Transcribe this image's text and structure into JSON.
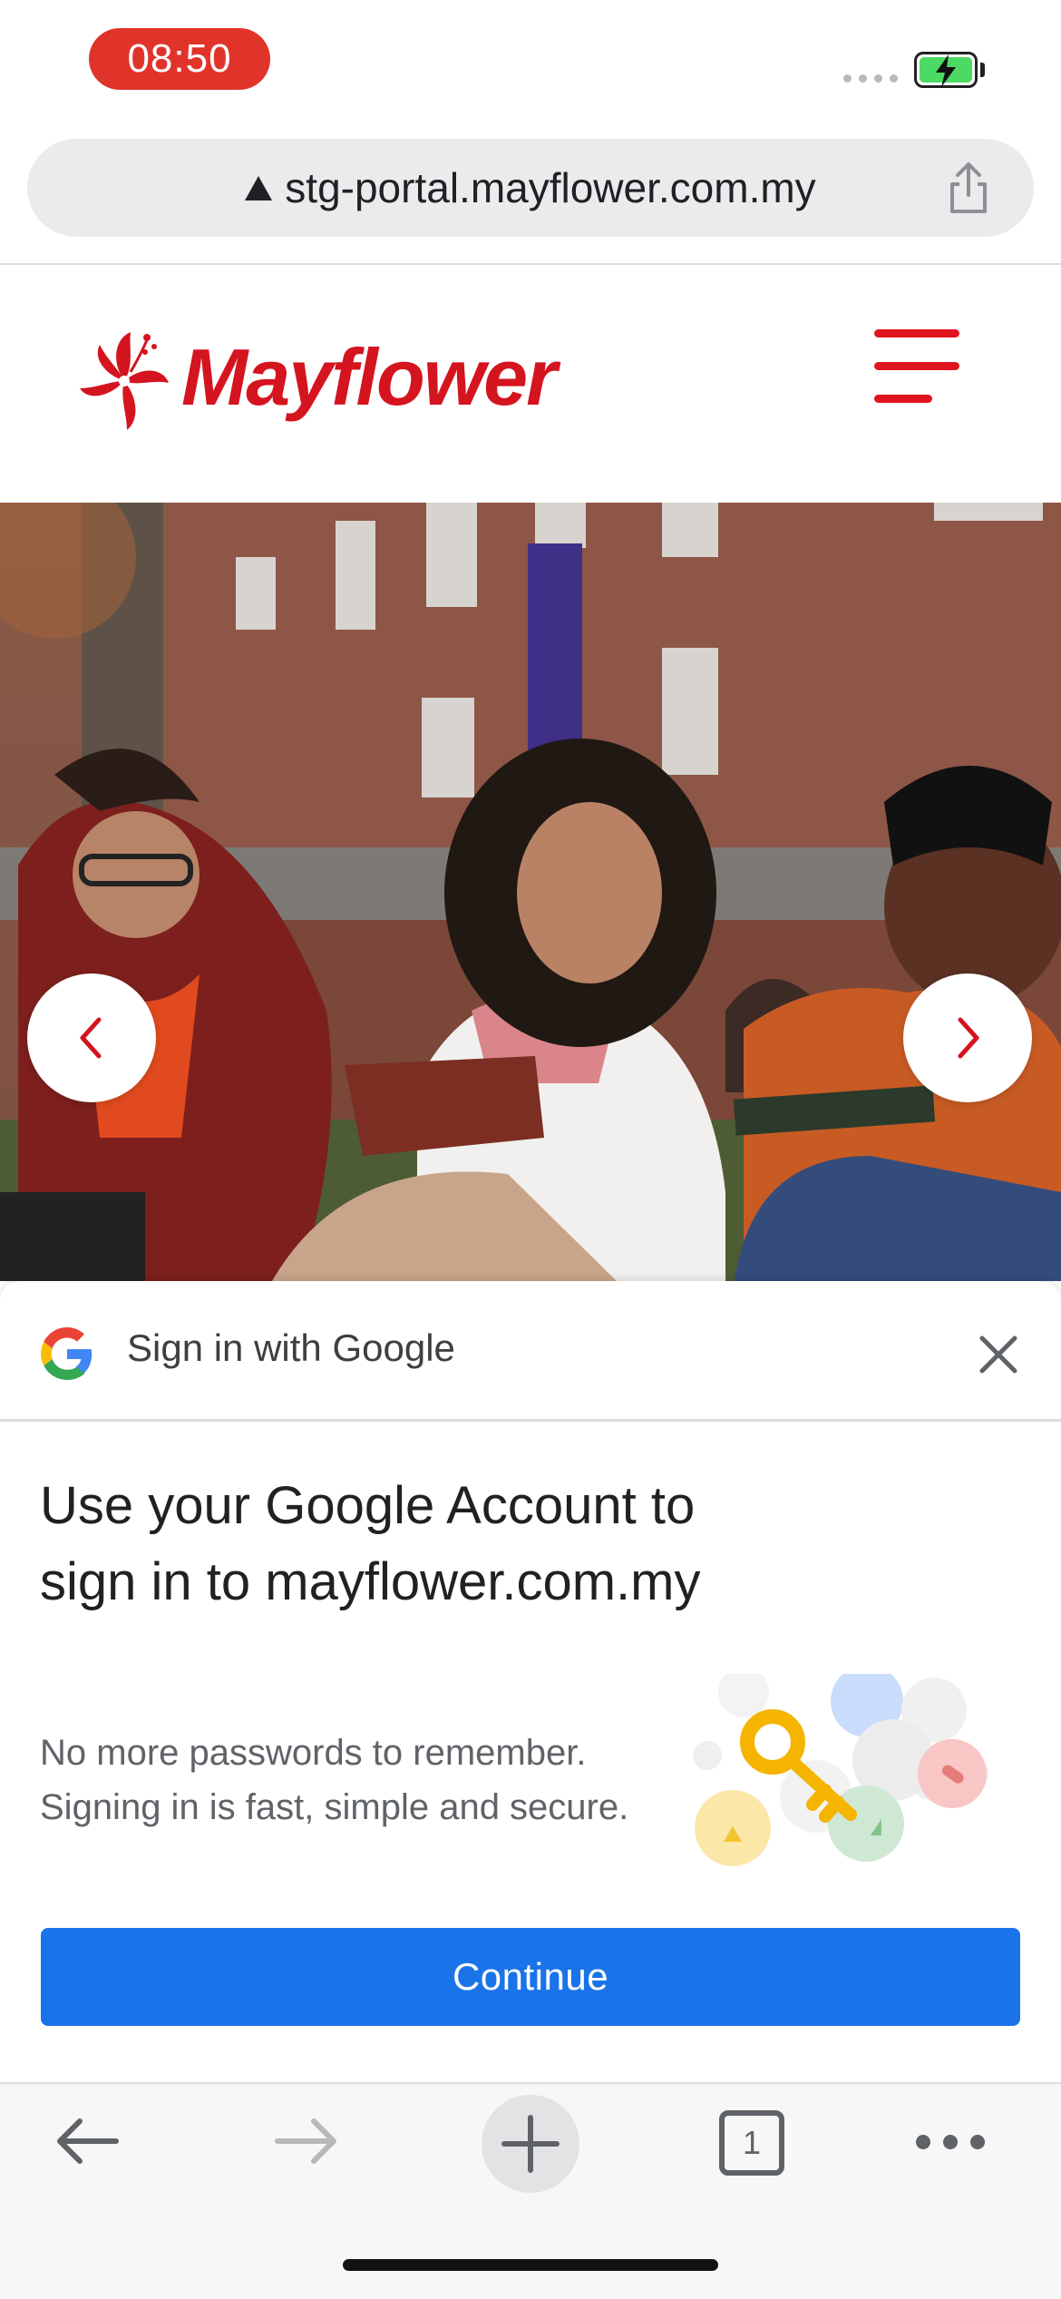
{
  "status_bar": {
    "time": "08:50",
    "battery_state": "charging",
    "battery_color": "#4cd964"
  },
  "browser": {
    "url": "stg-portal.mayflower.com.my",
    "security_icon": "warning-triangle-icon",
    "share_icon": "share-icon"
  },
  "site": {
    "logo_text": "Mayflower",
    "brand_color": "#d4141f",
    "menu_icon": "hamburger-menu-icon"
  },
  "hero": {
    "prev_icon": "chevron-left-icon",
    "next_icon": "chevron-right-icon"
  },
  "google_sheet": {
    "header_title": "Sign in with Google",
    "headline": "Use your Google Account to sign in to mayflower.com.my",
    "subtext": "No more passwords to remember. Signing in is fast, simple and secure.",
    "continue_label": "Continue",
    "button_color": "#1a73e8"
  },
  "toolbar": {
    "tab_count": "1",
    "icons": [
      "back-icon",
      "forward-icon",
      "new-tab-icon",
      "tabs-icon",
      "more-icon"
    ]
  }
}
